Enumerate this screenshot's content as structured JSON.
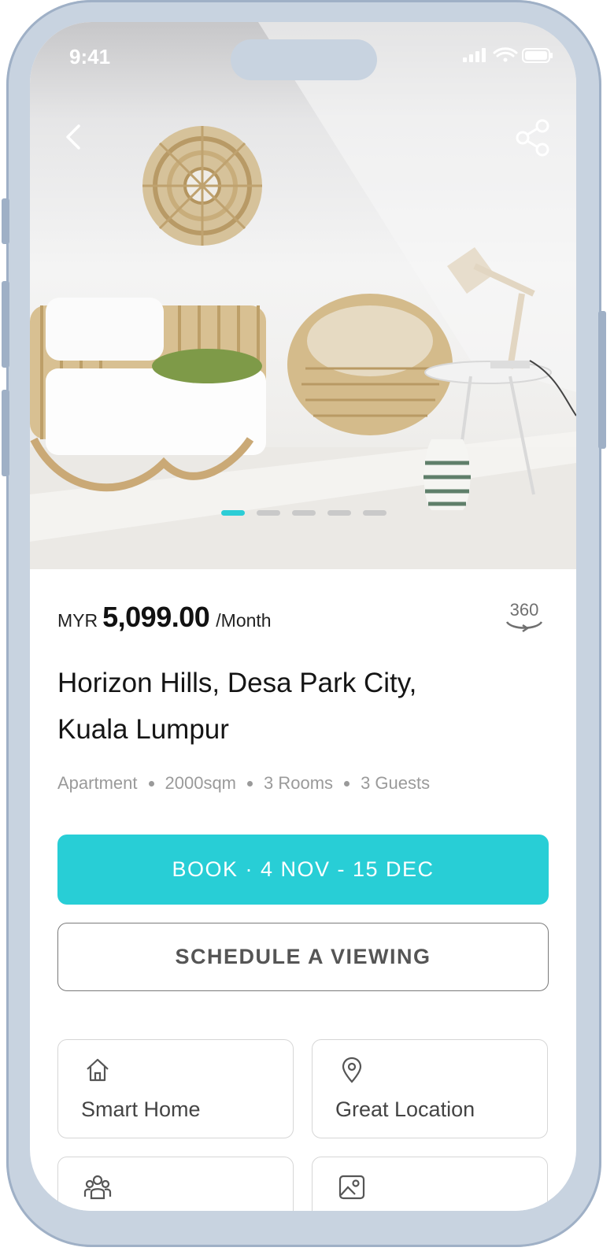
{
  "status_bar": {
    "time": "9:41"
  },
  "gallery": {
    "total_images": 5,
    "active_index": 0
  },
  "listing": {
    "currency": "MYR",
    "price": "5,099.00",
    "period": "/Month",
    "view_360_label": "360",
    "title_line1": "Horizon Hills, Desa Park City,",
    "title_line2": "Kuala Lumpur",
    "type": "Apartment",
    "size": "2000sqm",
    "rooms": "3 Rooms",
    "guests": "3 Guests"
  },
  "actions": {
    "book_label": "BOOK · 4 NOV - 15 DEC",
    "viewing_label": "SCHEDULE A VIEWING"
  },
  "features": [
    {
      "label": "Smart Home",
      "icon": "home-icon"
    },
    {
      "label": "Great Location",
      "icon": "location-pin-icon"
    },
    {
      "label": "",
      "icon": "people-icon"
    },
    {
      "label": "",
      "icon": "image-icon"
    }
  ],
  "colors": {
    "accent": "#28ced6",
    "frame": "#c8d3e0"
  }
}
